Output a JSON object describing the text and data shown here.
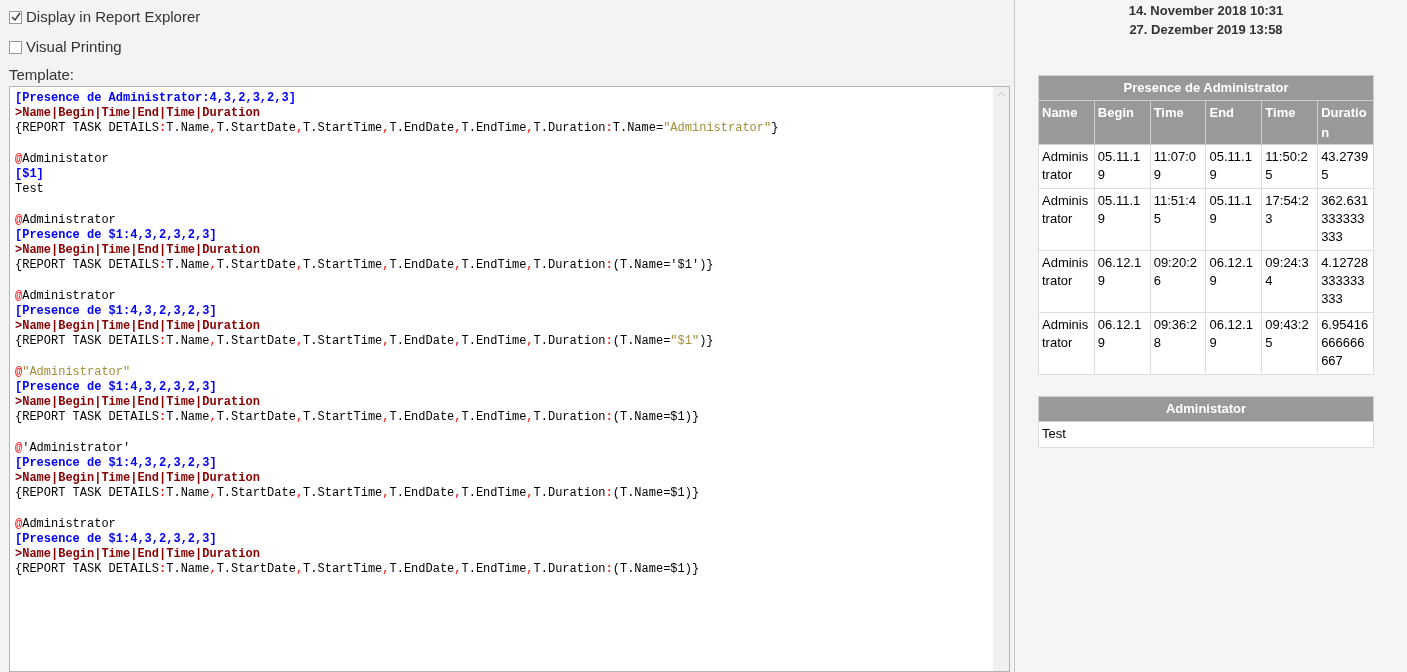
{
  "options": [
    {
      "label": "Display in Report Explorer",
      "checked": true
    },
    {
      "label": "Visual Printing",
      "checked": false
    }
  ],
  "template": {
    "label": "Template:",
    "blocks": [
      [
        [
          {
            "kind": "section",
            "text": "[Presence de Administrator:4,3,2,3,2,3]"
          }
        ],
        [
          {
            "kind": "columns",
            "text": ">Name|Begin|Time|End|Time|Duration"
          }
        ],
        [
          {
            "kind": "plain",
            "text": "{REPORT TASK DETAILS"
          },
          {
            "kind": "punct",
            "text": ":"
          },
          {
            "kind": "plain",
            "text": "T.Name"
          },
          {
            "kind": "punct",
            "text": ","
          },
          {
            "kind": "plain",
            "text": "T.StartDate"
          },
          {
            "kind": "punct",
            "text": ","
          },
          {
            "kind": "plain",
            "text": "T.StartTime"
          },
          {
            "kind": "punct",
            "text": ","
          },
          {
            "kind": "plain",
            "text": "T.EndDate"
          },
          {
            "kind": "punct",
            "text": ","
          },
          {
            "kind": "plain",
            "text": "T.EndTime"
          },
          {
            "kind": "punct",
            "text": ","
          },
          {
            "kind": "plain",
            "text": "T.Duration"
          },
          {
            "kind": "punct",
            "text": ":"
          },
          {
            "kind": "plain",
            "text": "T.Name="
          },
          {
            "kind": "string",
            "text": "\"Administrator\""
          },
          {
            "kind": "plain",
            "text": "}"
          }
        ]
      ],
      [
        [
          {
            "kind": "at",
            "text": "@"
          },
          {
            "kind": "plain",
            "text": "Administator"
          }
        ],
        [
          {
            "kind": "section",
            "text": "[$1]"
          }
        ],
        [
          {
            "kind": "plain",
            "text": "Test"
          }
        ]
      ],
      [
        [
          {
            "kind": "at",
            "text": "@"
          },
          {
            "kind": "plain",
            "text": "Administrator"
          }
        ],
        [
          {
            "kind": "section",
            "text": "[Presence de $1:4,3,2,3,2,3]"
          }
        ],
        [
          {
            "kind": "columns",
            "text": ">Name|Begin|Time|End|Time|Duration"
          }
        ],
        [
          {
            "kind": "plain",
            "text": "{REPORT TASK DETAILS"
          },
          {
            "kind": "punct",
            "text": ":"
          },
          {
            "kind": "plain",
            "text": "T.Name"
          },
          {
            "kind": "punct",
            "text": ","
          },
          {
            "kind": "plain",
            "text": "T.StartDate"
          },
          {
            "kind": "punct",
            "text": ","
          },
          {
            "kind": "plain",
            "text": "T.StartTime"
          },
          {
            "kind": "punct",
            "text": ","
          },
          {
            "kind": "plain",
            "text": "T.EndDate"
          },
          {
            "kind": "punct",
            "text": ","
          },
          {
            "kind": "plain",
            "text": "T.EndTime"
          },
          {
            "kind": "punct",
            "text": ","
          },
          {
            "kind": "plain",
            "text": "T.Duration"
          },
          {
            "kind": "punct",
            "text": ":"
          },
          {
            "kind": "plain",
            "text": "(T.Name='$1')}"
          }
        ]
      ],
      [
        [
          {
            "kind": "at",
            "text": "@"
          },
          {
            "kind": "plain",
            "text": "Administrator"
          }
        ],
        [
          {
            "kind": "section",
            "text": "[Presence de $1:4,3,2,3,2,3]"
          }
        ],
        [
          {
            "kind": "columns",
            "text": ">Name|Begin|Time|End|Time|Duration"
          }
        ],
        [
          {
            "kind": "plain",
            "text": "{REPORT TASK DETAILS"
          },
          {
            "kind": "punct",
            "text": ":"
          },
          {
            "kind": "plain",
            "text": "T.Name"
          },
          {
            "kind": "punct",
            "text": ","
          },
          {
            "kind": "plain",
            "text": "T.StartDate"
          },
          {
            "kind": "punct",
            "text": ","
          },
          {
            "kind": "plain",
            "text": "T.StartTime"
          },
          {
            "kind": "punct",
            "text": ","
          },
          {
            "kind": "plain",
            "text": "T.EndDate"
          },
          {
            "kind": "punct",
            "text": ","
          },
          {
            "kind": "plain",
            "text": "T.EndTime"
          },
          {
            "kind": "punct",
            "text": ","
          },
          {
            "kind": "plain",
            "text": "T.Duration"
          },
          {
            "kind": "punct",
            "text": ":"
          },
          {
            "kind": "plain",
            "text": "(T.Name="
          },
          {
            "kind": "string",
            "text": "\"$1\""
          },
          {
            "kind": "plain",
            "text": ")}"
          }
        ]
      ],
      [
        [
          {
            "kind": "at",
            "text": "@"
          },
          {
            "kind": "string",
            "text": "\"Administrator\""
          }
        ],
        [
          {
            "kind": "section",
            "text": "[Presence de $1:4,3,2,3,2,3]"
          }
        ],
        [
          {
            "kind": "columns",
            "text": ">Name|Begin|Time|End|Time|Duration"
          }
        ],
        [
          {
            "kind": "plain",
            "text": "{REPORT TASK DETAILS"
          },
          {
            "kind": "punct",
            "text": ":"
          },
          {
            "kind": "plain",
            "text": "T.Name"
          },
          {
            "kind": "punct",
            "text": ","
          },
          {
            "kind": "plain",
            "text": "T.StartDate"
          },
          {
            "kind": "punct",
            "text": ","
          },
          {
            "kind": "plain",
            "text": "T.StartTime"
          },
          {
            "kind": "punct",
            "text": ","
          },
          {
            "kind": "plain",
            "text": "T.EndDate"
          },
          {
            "kind": "punct",
            "text": ","
          },
          {
            "kind": "plain",
            "text": "T.EndTime"
          },
          {
            "kind": "punct",
            "text": ","
          },
          {
            "kind": "plain",
            "text": "T.Duration"
          },
          {
            "kind": "punct",
            "text": ":"
          },
          {
            "kind": "plain",
            "text": "(T.Name=$1)}"
          }
        ]
      ],
      [
        [
          {
            "kind": "at",
            "text": "@"
          },
          {
            "kind": "plain",
            "text": "'Administrator'"
          }
        ],
        [
          {
            "kind": "section",
            "text": "[Presence de $1:4,3,2,3,2,3]"
          }
        ],
        [
          {
            "kind": "columns",
            "text": ">Name|Begin|Time|End|Time|Duration"
          }
        ],
        [
          {
            "kind": "plain",
            "text": "{REPORT TASK DETAILS"
          },
          {
            "kind": "punct",
            "text": ":"
          },
          {
            "kind": "plain",
            "text": "T.Name"
          },
          {
            "kind": "punct",
            "text": ","
          },
          {
            "kind": "plain",
            "text": "T.StartDate"
          },
          {
            "kind": "punct",
            "text": ","
          },
          {
            "kind": "plain",
            "text": "T.StartTime"
          },
          {
            "kind": "punct",
            "text": ","
          },
          {
            "kind": "plain",
            "text": "T.EndDate"
          },
          {
            "kind": "punct",
            "text": ","
          },
          {
            "kind": "plain",
            "text": "T.EndTime"
          },
          {
            "kind": "punct",
            "text": ","
          },
          {
            "kind": "plain",
            "text": "T.Duration"
          },
          {
            "kind": "punct",
            "text": ":"
          },
          {
            "kind": "plain",
            "text": "(T.Name=$1)}"
          }
        ]
      ],
      [
        [
          {
            "kind": "at",
            "text": "@"
          },
          {
            "kind": "plain",
            "text": "Administrator"
          }
        ],
        [
          {
            "kind": "section",
            "text": "[Presence de $1:4,3,2,3,2,3]"
          }
        ],
        [
          {
            "kind": "columns",
            "text": ">Name|Begin|Time|End|Time|Duration"
          }
        ],
        [
          {
            "kind": "plain",
            "text": "{REPORT TASK DETAILS"
          },
          {
            "kind": "punct",
            "text": ":"
          },
          {
            "kind": "plain",
            "text": "T.Name"
          },
          {
            "kind": "punct",
            "text": ","
          },
          {
            "kind": "plain",
            "text": "T.StartDate"
          },
          {
            "kind": "punct",
            "text": ","
          },
          {
            "kind": "plain",
            "text": "T.StartTime"
          },
          {
            "kind": "punct",
            "text": ","
          },
          {
            "kind": "plain",
            "text": "T.EndDate"
          },
          {
            "kind": "punct",
            "text": ","
          },
          {
            "kind": "plain",
            "text": "T.EndTime"
          },
          {
            "kind": "punct",
            "text": ","
          },
          {
            "kind": "plain",
            "text": "T.Duration"
          },
          {
            "kind": "punct",
            "text": ":"
          },
          {
            "kind": "plain",
            "text": "(T.Name=$1)}"
          }
        ]
      ]
    ]
  },
  "preview": {
    "dates": [
      "14. November 2018 10:31",
      "27. Dezember 2019 13:58"
    ],
    "tables": [
      {
        "title": "Presence de Administrator",
        "columns": [
          "Name",
          "Begin",
          "Time",
          "End",
          "Time",
          "Duration"
        ],
        "rows": [
          [
            "Administrator",
            "05.11.19",
            "11:07:09",
            "05.11.19",
            "11:50:25",
            "43.27395"
          ],
          [
            "Administrator",
            "05.11.19",
            "11:51:45",
            "05.11.19",
            "17:54:23",
            "362.631333333333"
          ],
          [
            "Administrator",
            "06.12.19",
            "09:20:26",
            "06.12.19",
            "09:24:34",
            "4.12728333333333"
          ],
          [
            "Administrator",
            "06.12.19",
            "09:36:28",
            "06.12.19",
            "09:43:25",
            "6.95416666666667"
          ]
        ]
      },
      {
        "title": "Administator",
        "rows": [
          [
            "Test"
          ]
        ]
      }
    ]
  }
}
